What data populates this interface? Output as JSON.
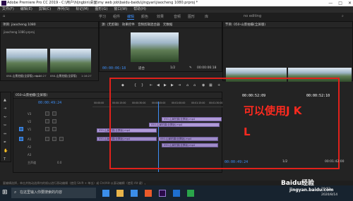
{
  "app": {
    "title": "Adobe Premiere Pro CC 2019 - C:\\用户\\hljngbin\\桌面\\my web job\\baidu-baidu\\jingyan\\jiaocheng 1080.prproj *",
    "window_buttons": [
      "—",
      "□",
      "✕"
    ]
  },
  "menu": {
    "items": [
      "文件(F)",
      "编辑(E)",
      "剪辑(C)",
      "序列(S)",
      "标记(M)",
      "图形(G)",
      "窗口(W)",
      "帮助(H)"
    ]
  },
  "workspaces": {
    "tabs": [
      "学习",
      "组件",
      "编辑",
      "颜色",
      "效果",
      "音频",
      "图形",
      "库",
      "no editing"
    ],
    "active_index": 2
  },
  "source_panel": {
    "tabs": [
      "源: (无剪辑)",
      "效果控件",
      "音频剪辑混合器",
      "元数据"
    ],
    "timecode_left": "00:00:06:18",
    "fit_label": "适合",
    "fraction": "1/2",
    "timecode_right": "00:00:06:18"
  },
  "project_panel": {
    "title": "项目: jiaocheng 1080",
    "file": "jiaocheng 1080.prproj",
    "items": [
      {
        "name": "050-山景拍摄(全屏版).mp4",
        "duration": "1:16:27"
      },
      {
        "name": "050-山景拍摄(全屏版)",
        "duration": "1:16:27"
      }
    ]
  },
  "program_panel": {
    "title": "节目: 050-山景拍摄(全屏版)",
    "timecode_left": "00:00:49:24",
    "fraction": "1/2",
    "timecode_right": "00:01:42:00",
    "trim_tc_left": "00:00:52:09",
    "trim_tc_right": "00:00:52:10"
  },
  "timeline": {
    "sequence_name": "050-山景拍摄(全屏版)",
    "timecode": "00:00:49:24",
    "ruler_labels": [
      "00:00:00",
      "00:00:15:00",
      "00:00:30:00",
      "00:00:45:00",
      "00:01:00:00",
      "00:01:15:00",
      "00:01:30:00",
      "00:01:45:00"
    ],
    "tracks": [
      "V3",
      "V2",
      "V1",
      "A1",
      "A2",
      "A3",
      "主声道"
    ],
    "master_value": "0.0",
    "clips_video": [
      "050-山景拍摄(全屏版).mp4",
      "050-山景拍摄(全屏版).mp4",
      "050-山景拍摄(全屏版).mp4"
    ],
    "clips_audio": [
      "050-山景拍摄(全屏版).mp4",
      "050-山景拍摄(全屏版).mp4",
      "050-山景拍摄(全屏版).mp4"
    ]
  },
  "overlay": {
    "line1": "可以使用J K",
    "line2": "L"
  },
  "status": {
    "text": "要编辑选择，单击并拖动选择内的帧以进行滑动编辑（使用 Shift + 单击）或 Ctrl/Alt 以滚动编辑（使用 Alt 键）。"
  },
  "taskbar": {
    "search_placeholder": "在这里输入你要搜索的内容",
    "time": "20:52",
    "date": "2020/8/14"
  },
  "watermark": {
    "brand": "Baidu经验",
    "url": "jingyan.baidu.com"
  },
  "colors": {
    "accent": "#3e8ef7",
    "clip": "#b09ad8",
    "annotation": "#e0211b"
  }
}
